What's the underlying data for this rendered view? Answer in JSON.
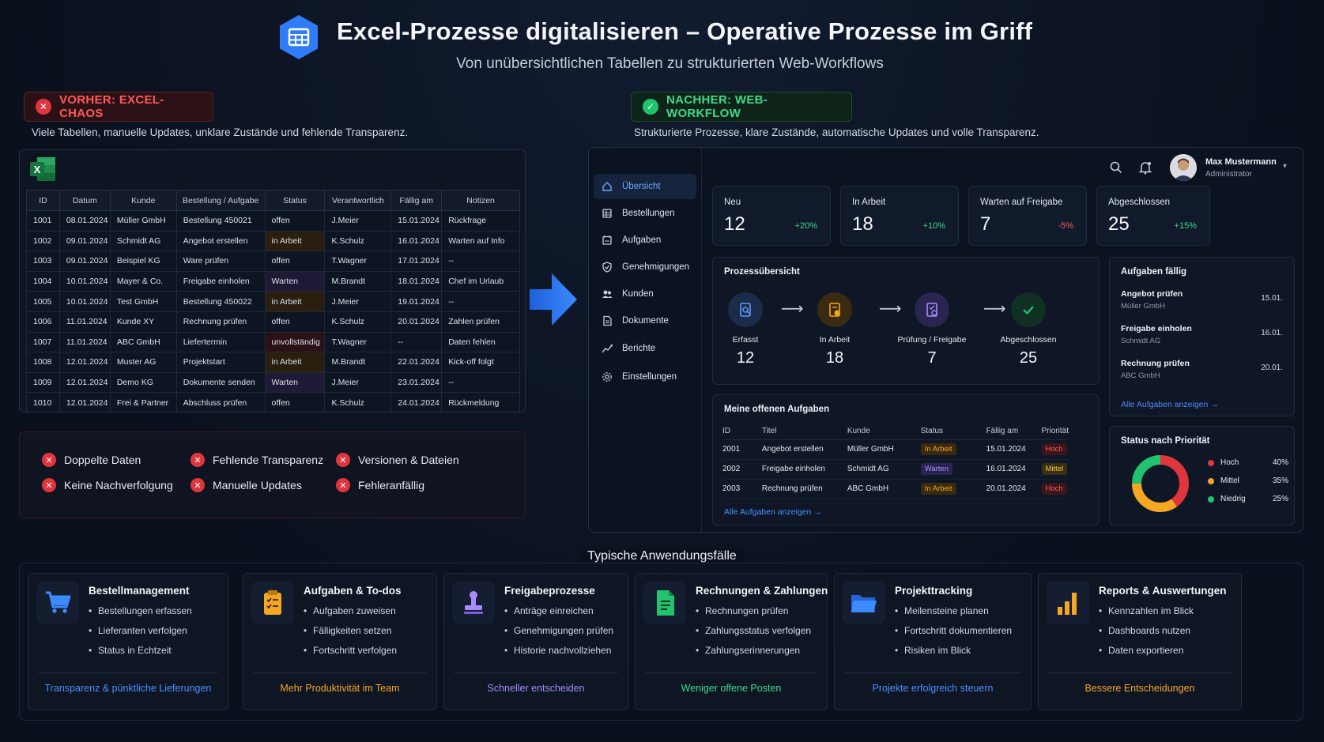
{
  "header": {
    "title": "Excel-Prozesse digitalisieren – Operative Prozesse im Griff",
    "subtitle": "Von unübersichtlichen Tabellen zu strukturierten Web-Workflows"
  },
  "before": {
    "badge": "VORHER: EXCEL-CHAOS",
    "description": "Viele Tabellen, manuelle Updates, unklare Zustände und fehlende Transparenz.",
    "table": {
      "columns": [
        "ID",
        "Datum",
        "Kunde",
        "Bestellung / Aufgabe",
        "Status",
        "Verantwortlich",
        "Fällig am",
        "Notizen"
      ],
      "rows": [
        [
          "1001",
          "08.01.2024",
          "Müller GmbH",
          "Bestellung 450021",
          "offen",
          "J.Meier",
          "15.01.2024",
          "Rückfrage"
        ],
        [
          "1002",
          "09.01.2024",
          "Schmidt AG",
          "Angebot erstellen",
          "in Arbeit",
          "K.Schulz",
          "16.01.2024",
          "Warten auf Info"
        ],
        [
          "1003",
          "09.01.2024",
          "Beispiel KG",
          "Ware prüfen",
          "offen",
          "T.Wagner",
          "17.01.2024",
          "--"
        ],
        [
          "1004",
          "10.01.2024",
          "Mayer & Co.",
          "Freigabe einholen",
          "Warten",
          "M.Brandt",
          "18.01.2024",
          "Chef im Urlaub"
        ],
        [
          "1005",
          "10.01.2024",
          "Test GmbH",
          "Bestellung 450022",
          "in Arbeit",
          "J.Meier",
          "19.01.2024",
          "--"
        ],
        [
          "1006",
          "11.01.2024",
          "Kunde XY",
          "Rechnung prüfen",
          "offen",
          "K.Schulz",
          "20.01.2024",
          "Zahlen prüfen"
        ],
        [
          "1007",
          "11.01.2024",
          "ABC GmbH",
          "Liefertermin",
          "unvollständig",
          "T.Wagner",
          "--",
          "Daten fehlen"
        ],
        [
          "1008",
          "12.01.2024",
          "Muster AG",
          "Projektstart",
          "in Arbeit",
          "M.Brandt",
          "22.01.2024",
          "Kick-off folgt"
        ],
        [
          "1009",
          "12.01.2024",
          "Demo KG",
          "Dokumente senden",
          "Warten",
          "J.Meier",
          "23.01.2024",
          "--"
        ],
        [
          "1010",
          "12.01.2024",
          "Frei & Partner",
          "Abschluss prüfen",
          "offen",
          "K.Schulz",
          "24.01.2024",
          "Rückmeldung"
        ]
      ]
    },
    "problems": [
      "Doppelte Daten",
      "Fehlende Transparenz",
      "Versionen & Dateien",
      "Keine Nachverfolgung",
      "Manuelle Updates",
      "Fehleranfällig"
    ]
  },
  "after": {
    "badge": "NACHHER: WEB-WORKFLOW",
    "description": "Strukturierte Prozesse, klare Zustände, automatische Updates und volle Transparenz.",
    "user": {
      "name": "Max Mustermann",
      "role": "Administrator"
    },
    "nav": [
      "Übersicht",
      "Bestellungen",
      "Aufgaben",
      "Genehmigungen",
      "Kunden",
      "Dokumente",
      "Berichte",
      "Einstellungen"
    ],
    "kpis": [
      {
        "label": "Neu",
        "value": "12",
        "change": "+20%"
      },
      {
        "label": "In Arbeit",
        "value": "18",
        "change": "+10%"
      },
      {
        "label": "Warten auf Freigabe",
        "value": "7",
        "change": "-5%"
      },
      {
        "label": "Abgeschlossen",
        "value": "25",
        "change": "+15%"
      }
    ],
    "process": {
      "title": "Prozessübersicht",
      "steps": [
        {
          "label": "Erfasst",
          "value": "12"
        },
        {
          "label": "In Arbeit",
          "value": "18"
        },
        {
          "label": "Prüfung / Freigabe",
          "value": "7"
        },
        {
          "label": "Abgeschlossen",
          "value": "25"
        }
      ]
    },
    "due": {
      "title": "Aufgaben fällig",
      "items": [
        {
          "task": "Angebot prüfen",
          "customer": "Müller GmbH",
          "date": "15.01."
        },
        {
          "task": "Freigabe einholen",
          "customer": "Schmidt AG",
          "date": "16.01."
        },
        {
          "task": "Rechnung prüfen",
          "customer": "ABC GmbH",
          "date": "20.01."
        }
      ],
      "link": "Alle Aufgaben anzeigen"
    },
    "tasks": {
      "title": "Meine offenen Aufgaben",
      "columns": [
        "ID",
        "Titel",
        "Kunde",
        "Status",
        "Fällig am",
        "Priorität"
      ],
      "rows": [
        [
          "2001",
          "Angebot erstellen",
          "Müller GmbH",
          "In Arbeit",
          "15.01.2024",
          "Hoch"
        ],
        [
          "2002",
          "Freigabe einholen",
          "Schmidt AG",
          "Warten",
          "16.01.2024",
          "Mittel"
        ],
        [
          "2003",
          "Rechnung prüfen",
          "ABC GmbH",
          "In Arbeit",
          "20.01.2024",
          "Hoch"
        ]
      ],
      "link": "Alle Aufgaben anzeigen"
    },
    "priority": {
      "title": "Status nach Priorität",
      "items": [
        {
          "label": "Hoch",
          "pct": "40%",
          "value": 40,
          "color": "#e0353d"
        },
        {
          "label": "Mittel",
          "pct": "35%",
          "value": 35,
          "color": "#f5a623"
        },
        {
          "label": "Niedrig",
          "pct": "25%",
          "value": 25,
          "color": "#22c36e"
        }
      ]
    }
  },
  "usecases": {
    "title": "Typische Anwendungsfälle",
    "cards": [
      {
        "name": "Bestellmanagement",
        "icon": "cart-icon",
        "items": [
          "Bestellungen erfassen",
          "Lieferanten verfolgen",
          "Status in Echtzeit"
        ],
        "footer": "Transparenz & pünktliche Lieferungen",
        "color": "#4c8dff"
      },
      {
        "name": "Aufgaben & To-dos",
        "icon": "clipboard-icon",
        "items": [
          "Aufgaben zuweisen",
          "Fälligkeiten setzen",
          "Fortschritt verfolgen"
        ],
        "footer": "Mehr Produktivität im Team",
        "color": "#f5a623"
      },
      {
        "name": "Freigabeprozesse",
        "icon": "stamp-icon",
        "items": [
          "Anträge einreichen",
          "Genehmigungen prüfen",
          "Historie nachvollziehen"
        ],
        "footer": "Schneller entscheiden",
        "color": "#a78bfa"
      },
      {
        "name": "Rechnungen & Zahlungen",
        "icon": "invoice-icon",
        "items": [
          "Rechnungen prüfen",
          "Zahlungsstatus verfolgen",
          "Zahlungserinnerungen"
        ],
        "footer": "Weniger offene Posten",
        "color": "#3fd98a"
      },
      {
        "name": "Projekttracking",
        "icon": "folder-icon",
        "items": [
          "Meilensteine planen",
          "Fortschritt dokumentieren",
          "Risiken im Blick"
        ],
        "footer": "Projekte erfolgreich steuern",
        "color": "#4c8dff"
      },
      {
        "name": "Reports & Auswertungen",
        "icon": "bar-chart-icon",
        "items": [
          "Kennzahlen im Blick",
          "Dashboards nutzen",
          "Daten exportieren"
        ],
        "footer": "Bessere Entscheidungen",
        "color": "#f5a623"
      }
    ]
  }
}
